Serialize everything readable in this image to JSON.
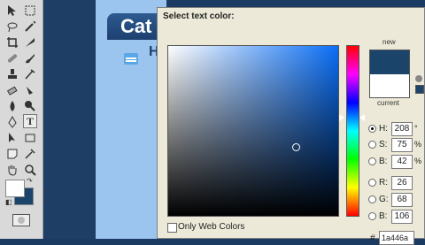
{
  "dialog": {
    "title": "Select text color:",
    "new_label": "new",
    "current_label": "current",
    "fields": {
      "H": {
        "label": "H:",
        "value": "208",
        "unit": "°"
      },
      "S": {
        "label": "S:",
        "value": "75",
        "unit": "%"
      },
      "B": {
        "label": "B:",
        "value": "42",
        "unit": "%"
      },
      "R": {
        "label": "R:",
        "value": "26",
        "unit": ""
      },
      "G": {
        "label": "G:",
        "value": "68",
        "unit": ""
      },
      "Bb": {
        "label": "B:",
        "value": "106",
        "unit": ""
      }
    },
    "hex_label": "#",
    "hex_value": "1a446a",
    "only_web_colors_label": "Only Web Colors",
    "new_color": "#1a446a",
    "current_color": "#ffffff"
  },
  "canvas": {
    "banner_text": "Cat",
    "subheading_text": "H"
  },
  "toolbar": {
    "foreground_color": "#ffffff",
    "background_color": "#1a446a",
    "icons": [
      "move-icon",
      "marquee-icon",
      "lasso-icon",
      "magic-wand-icon",
      "crop-icon",
      "slice-icon",
      "healing-icon",
      "brush-icon",
      "stamp-icon",
      "history-brush-icon",
      "eraser-icon",
      "gradient-icon",
      "blur-icon",
      "dodge-icon",
      "pen-icon",
      "type-icon",
      "path-select-icon",
      "shape-icon",
      "notes-icon",
      "eyedropper-icon",
      "hand-icon",
      "zoom-icon"
    ]
  }
}
